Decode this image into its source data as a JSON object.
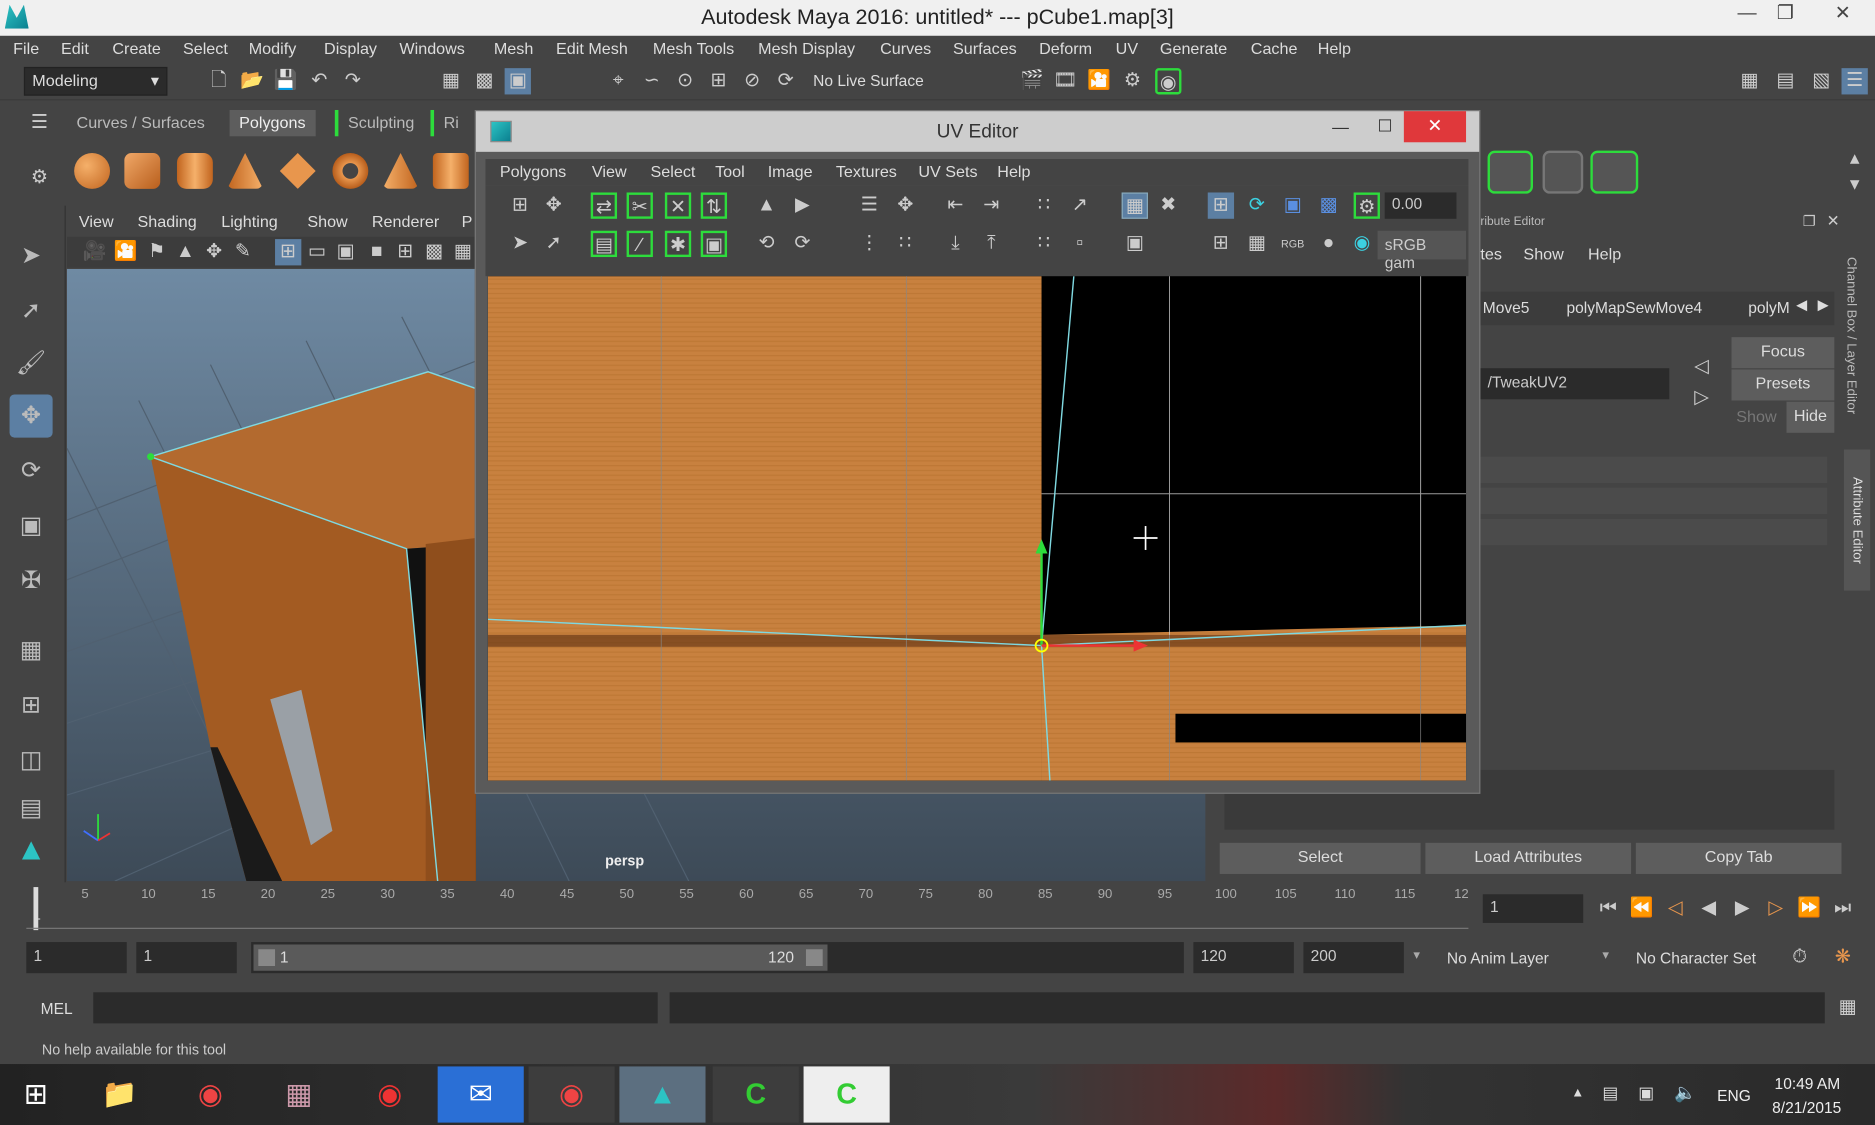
{
  "titlebar": {
    "title": "Autodesk Maya 2016: untitled*   ---   pCube1.map[3]"
  },
  "menus": [
    "File",
    "Edit",
    "Create",
    "Select",
    "Modify",
    "Display",
    "Windows",
    "Mesh",
    "Edit Mesh",
    "Mesh Tools",
    "Mesh Display",
    "Curves",
    "Surfaces",
    "Deform",
    "UV",
    "Generate",
    "Cache",
    "Help"
  ],
  "status": {
    "mode": "Modeling",
    "live_surface": "No Live Surface"
  },
  "shelf": {
    "tabs": [
      "Curves / Surfaces",
      "Polygons",
      "Sculpting",
      "Ri"
    ],
    "active": "Polygons"
  },
  "panel": {
    "menus": [
      "View",
      "Shading",
      "Lighting",
      "Show",
      "Renderer",
      "P"
    ],
    "camera_label": "persp"
  },
  "uv_editor": {
    "title": "UV Editor",
    "menus": [
      "Polygons",
      "View",
      "Select",
      "Tool",
      "Image",
      "Textures",
      "UV Sets",
      "Help"
    ],
    "value_field": "0.00",
    "colorspace": "sRGB gam"
  },
  "channel_box": {
    "header": "ribute Editor",
    "menus": [
      "tes",
      "Show",
      "Help"
    ],
    "node_tabs": [
      "Move5",
      "polyMapSewMove4",
      "polyM"
    ],
    "node_name": "/TweakUV2",
    "focus_label": "Focus",
    "presets_label": "Presets",
    "show_label": "Show",
    "hide_label": "Hide",
    "select_label": "Select",
    "load_attributes_label": "Load Attributes",
    "copy_tab_label": "Copy Tab",
    "side_tabs": [
      "Channel Box / Layer Editor",
      "Attribute Editor"
    ]
  },
  "timeline": {
    "ticks": [
      "5",
      "10",
      "15",
      "20",
      "25",
      "30",
      "35",
      "40",
      "45",
      "50",
      "55",
      "60",
      "65",
      "70",
      "75",
      "80",
      "85",
      "90",
      "95",
      "100",
      "105",
      "110",
      "115",
      "12"
    ],
    "current_frame": "1",
    "frame_start_marker": "1"
  },
  "range": {
    "start": "1",
    "anim_start": "1",
    "range_start_label": "1",
    "range_end_label": "120",
    "end": "120",
    "anim_end": "200",
    "anim_layer": "No Anim Layer",
    "character_set": "No Character Set"
  },
  "mel": {
    "label": "MEL"
  },
  "help": {
    "text": "No help available for this tool"
  },
  "taskbar": {
    "lang": "ENG",
    "time": "10:49 AM",
    "date": "8/21/2015"
  }
}
